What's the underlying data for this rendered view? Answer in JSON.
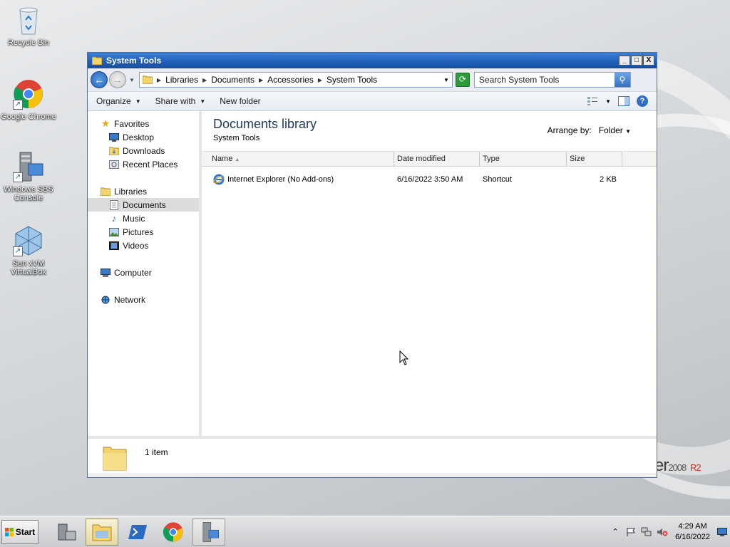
{
  "desktop": {
    "icons": [
      {
        "label": "Recycle Bin",
        "icon": "recycle-bin-icon"
      },
      {
        "label": "Google Chrome",
        "icon": "chrome-icon"
      },
      {
        "label": "Windows SBS Console",
        "icon": "server-console-icon"
      },
      {
        "label": "Sun xVM VirtualBox",
        "icon": "virtualbox-icon"
      }
    ],
    "brand": {
      "text": "er",
      "version": "2008",
      "edition": "R2"
    }
  },
  "window": {
    "title": "System Tools",
    "controls": {
      "minimize": "_",
      "maximize": "□",
      "close": "X"
    }
  },
  "address": {
    "breadcrumb": [
      "Libraries",
      "Documents",
      "Accessories",
      "System Tools"
    ],
    "search_placeholder": "Search System Tools"
  },
  "toolbar": {
    "organize": "Organize",
    "share_with": "Share with",
    "new_folder": "New folder"
  },
  "navpane": {
    "favorites": "Favorites",
    "favorites_items": [
      "Desktop",
      "Downloads",
      "Recent Places"
    ],
    "libraries": "Libraries",
    "libraries_items": [
      "Documents",
      "Music",
      "Pictures",
      "Videos"
    ],
    "selected": "Documents",
    "computer": "Computer",
    "network": "Network"
  },
  "content": {
    "title": "Documents library",
    "subtitle": "System Tools",
    "arrange_label": "Arrange by:",
    "arrange_value": "Folder",
    "columns": [
      "Name",
      "Date modified",
      "Type",
      "Size"
    ],
    "rows": [
      {
        "name": "Internet Explorer (No Add-ons)",
        "date": "6/16/2022 3:50 AM",
        "type": "Shortcut",
        "size": "2 KB"
      }
    ]
  },
  "status": {
    "count": "1 item"
  },
  "taskbar": {
    "start": "Start",
    "clock_time": "4:29 AM",
    "clock_date": "6/16/2022"
  }
}
